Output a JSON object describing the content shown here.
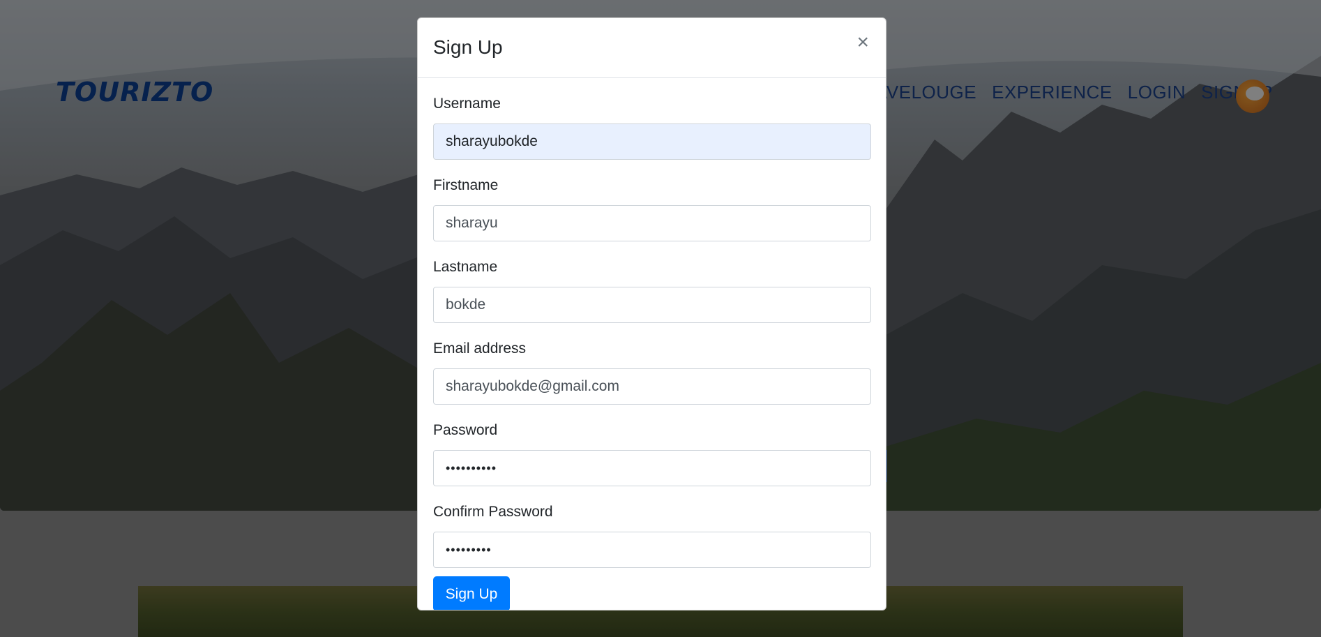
{
  "site": {
    "logo": "TOURIZTO",
    "nav": [
      "AVELOUGE",
      "EXPERIENCE",
      "LOGIN",
      "SIGNUP"
    ]
  },
  "modal": {
    "title": "Sign Up",
    "close_symbol": "×",
    "fields": [
      {
        "label": "Username",
        "value": "sharayubokde"
      },
      {
        "label": "Firstname",
        "value": "sharayu"
      },
      {
        "label": "Lastname",
        "value": "bokde"
      },
      {
        "label": "Email address",
        "value": "sharayubokde@gmail.com"
      },
      {
        "label": "Password",
        "value": "••••••••••"
      },
      {
        "label": "Confirm Password",
        "value": "•••••••••"
      }
    ],
    "submit_label": "Sign Up"
  },
  "colors": {
    "primary": "#007bff",
    "logo": "#0b3c8c",
    "nav": "#1a3f85",
    "autofill": "#e8f0fe"
  }
}
